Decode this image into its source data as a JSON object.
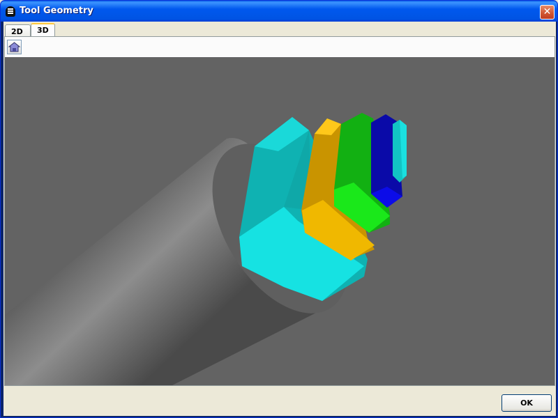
{
  "window": {
    "title": "Tool Geometry",
    "close_glyph": "✕"
  },
  "tabs": [
    {
      "label": "2D"
    },
    {
      "label": "3D",
      "selected": true
    }
  ],
  "toolbar": {
    "home_icon": "home-icon"
  },
  "viewport": {
    "background": "#636363",
    "cylinder_color": "#9a9a9a",
    "insert_colors": [
      "#18e2e2",
      "#e8ae00",
      "#19e41a",
      "#0a0ad8",
      "#16d8da"
    ]
  },
  "footer": {
    "ok_label": "OK"
  }
}
